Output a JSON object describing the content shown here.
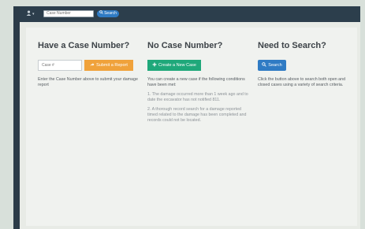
{
  "topbar": {
    "search_placeholder": "Case Number",
    "search_button_label": "Search"
  },
  "have_case": {
    "heading": "Have a Case Number?",
    "input_placeholder": "Case #",
    "submit_button_label": "Submit a Report",
    "description": "Enter the Case Number above to submit your damage report"
  },
  "no_case": {
    "heading": "No Case Number?",
    "create_button_label": "Create a New Case",
    "description": "You can create a new case if the following conditions have been met:",
    "conditions": [
      "1. The damage occurred more than 1 week ago and to date the excavator has not notified 811.",
      "2. A thorough record search for a damage reported timed related to the damage has been completed and records could not be located."
    ]
  },
  "need_search": {
    "heading": "Need to Search?",
    "search_button_label": "Search",
    "description": "Click the button above to search both open and closed cases using a variety of search criteria."
  },
  "colors": {
    "topbar": "#2c3e4c",
    "primary": "#2f7bc4",
    "warning": "#f0a23b",
    "success": "#1fa87a"
  }
}
